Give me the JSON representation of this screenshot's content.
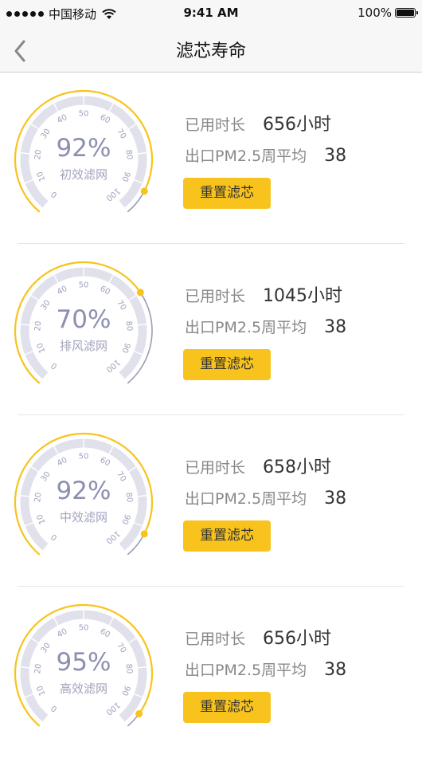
{
  "status_bar": {
    "carrier": "中国移动",
    "time": "9:41 AM",
    "battery": "100%"
  },
  "nav": {
    "title": "滤芯寿命",
    "back_icon": "chevron-left-icon"
  },
  "gauge_ticks": [
    "0",
    "10",
    "20",
    "30",
    "40",
    "50",
    "60",
    "70",
    "80",
    "90",
    "100"
  ],
  "colors": {
    "accent": "#f8c31c",
    "track": "#e1e1ec",
    "text_gauge": "#8c8fb0"
  },
  "filters": [
    {
      "percent_text": "92%",
      "percent_value": 92,
      "name": "初效滤网",
      "usage_label": "已用时长",
      "usage_value": "656小时",
      "pm_label": "出口PM2.5周平均",
      "pm_value": "38",
      "reset_label": "重置滤芯"
    },
    {
      "percent_text": "70%",
      "percent_value": 70,
      "name": "排风滤网",
      "usage_label": "已用时长",
      "usage_value": "1045小时",
      "pm_label": "出口PM2.5周平均",
      "pm_value": "38",
      "reset_label": "重置滤芯"
    },
    {
      "percent_text": "92%",
      "percent_value": 92,
      "name": "中效滤网",
      "usage_label": "已用时长",
      "usage_value": "658小时",
      "pm_label": "出口PM2.5周平均",
      "pm_value": "38",
      "reset_label": "重置滤芯"
    },
    {
      "percent_text": "95%",
      "percent_value": 95,
      "name": "高效滤网",
      "usage_label": "已用时长",
      "usage_value": "656小时",
      "pm_label": "出口PM2.5周平均",
      "pm_value": "38",
      "reset_label": "重置滤芯"
    }
  ]
}
